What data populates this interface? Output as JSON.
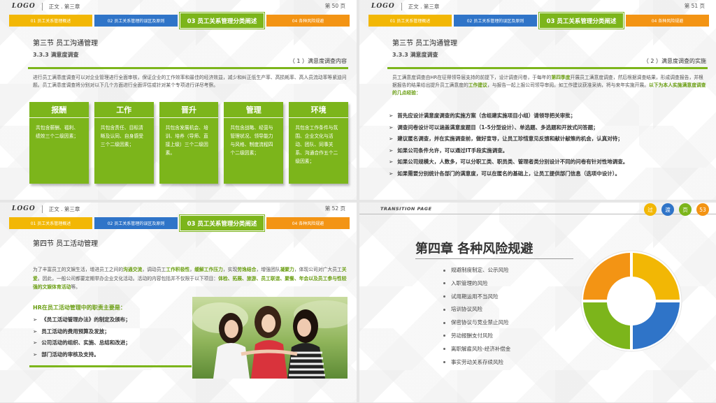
{
  "header": {
    "logo": "LOGO",
    "title": "正文 . 第三章"
  },
  "tabs": {
    "tab1": "01 员工关系管理概述",
    "tab2": "02 员工关系管理的误区及原则",
    "tab3": "03 员工关系管理分类阐述",
    "tab4": "04 各种风险规避"
  },
  "slide1": {
    "page": "第 50 页",
    "section": "第三节  员工沟通管理",
    "subsection": "3.3.3 满意度调查",
    "right_tag": "（ 1 ）满意度调查内容",
    "paragraph": "进行员工满意度调查可以对企业管理进行全面审核，保证企业的工作效率和最佳的经济效益，减少和纠正低生产率、高损耗率、高人员流动率等紧迫问题。员工满意度调查将分别对以下几个方面进行全面评估或针对某个专项进行详尽考察。",
    "cards": [
      {
        "title": "报酬",
        "text": "共包含薪酬、福利、绩效三个二级因素；"
      },
      {
        "title": "工作",
        "text": "共包含责任、目标清晰及认同、自身感受三个二级因素；"
      },
      {
        "title": "晋升",
        "text": "共包含发展机会、培训、培养（导师、直接上级）三个二级因素。"
      },
      {
        "title": "管理",
        "text": "共包含战略、经营与管理状况、领导能力与风格、制度流程四个二级因素；"
      },
      {
        "title": "环境",
        "text": "共包含工作条件与氛围、企业文化与活动、团队、同事关系、沟通合作五个二级因素；"
      }
    ]
  },
  "slide2": {
    "page": "第 51 页",
    "section": "第三节  员工沟通管理",
    "subsection": "3.3.3 满意度调查",
    "right_tag": "（ 2 ）满意度调查的实施",
    "para_a": "员工满意度调查由HR在征得领导层支持的前提下，设计调查问卷，于每年的",
    "para_b": "第四季度",
    "para_c": "开展员工满意度调查，然后根据调查结果，形成调查报告，并根据报告的结果给出提升员工满意度的",
    "para_d": "工作建议",
    "para_e": "，与报告一起上报公司领导审阅。如工作建议获准采纳，将与来年实施开展。",
    "para_f": "以下为本人实施满意度调查的几点经验：",
    "bullets": [
      "首先应设计满意度调查的实施方案（含组建实施项目小组）请领导把关审批；",
      "调查问卷设计可以涵盖满意度题目（1-5分型设计）、单选题、多选题和开放式问答题；",
      "建议匿名调查，并在实施调查前，做好宣导，让员工珍惜意见反馈和献计献策的机会，认真对待；",
      "如果公司条件允许，可以通过IT手段实施调查。",
      "如果公司规模大，人数多，可以分职工类、职员类、管理者类分别设计不同的问卷有针对性地调查。",
      "如果需要分别统计各部门的满意度，可以在匿名的基础上，让员工提供部门信息（选项中设计）。"
    ]
  },
  "slide3": {
    "page": "第 52 页",
    "section": "第四节  员工活动管理",
    "p1": "为了丰富员工的文娱生活，增进员工之间的",
    "p2": "沟通交流",
    "p3": "，调动员工",
    "p4": "工作积极性",
    "p5": "，",
    "p6": "缓解工作压力",
    "p7": "，实现",
    "p8": "劳逸结合",
    "p9": "，增强团队",
    "p10": "凝聚力",
    "p11": "，体现公司对广大员工",
    "p12": "关爱",
    "p13": "。因此，一般公司都要定期举办企业文化活动。活动的内容包括并不仅限于以下项目：",
    "p14": "体检、拓展、旅游、员工联谊、聚餐、年会以及员工参与性较强的文娱体育活动",
    "p15": "等。",
    "heading": "HR在员工活动管理中的职责主要是：",
    "bullets": [
      "《员工活动管理办法》的制定及颁布；",
      "员工活动的费用预算及发放；",
      "公司活动的组织、实施、总结和改进；",
      "部门活动的审核及支持。"
    ]
  },
  "slide4": {
    "transition": "TRANSITION PAGE",
    "circles": [
      "过",
      "渡",
      "页",
      "53"
    ],
    "chapter": "第四章  各种风险规避",
    "items": [
      "规避制度制定、公示风险",
      "入职管理的风险",
      "试用期运用不当风险",
      "培训协议风险",
      "保密协议与竞业禁止风险",
      "劳动报酬支付风险",
      "离职解雇风险-经济补偿金",
      "事实劳动关系存续风险"
    ],
    "colors": {
      "yellow": "#f2b705",
      "blue": "#2f74c8",
      "green": "#7cb51b",
      "orange": "#f39414"
    }
  }
}
